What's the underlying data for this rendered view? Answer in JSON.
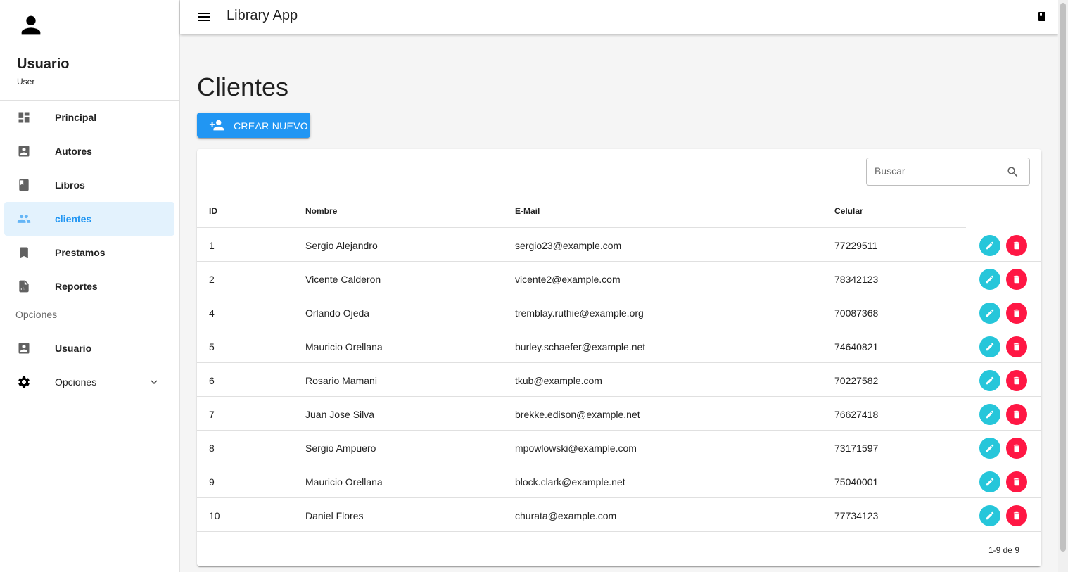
{
  "app": {
    "title": "Library App"
  },
  "profile": {
    "name": "Usuario",
    "role": "User"
  },
  "sidebar": {
    "items": [
      {
        "label": "Principal",
        "icon": "dashboard-icon"
      },
      {
        "label": "Autores",
        "icon": "account-box-icon"
      },
      {
        "label": "Libros",
        "icon": "book-icon"
      },
      {
        "label": "clientes",
        "icon": "people-icon",
        "active": true
      },
      {
        "label": "Prestamos",
        "icon": "bookmark-icon"
      },
      {
        "label": "Reportes",
        "icon": "report-icon"
      }
    ],
    "section_header": "Opciones",
    "options": [
      {
        "label": "Usuario",
        "icon": "account-box-icon"
      },
      {
        "label": "Opciones",
        "icon": "gear-icon",
        "expandable": true
      }
    ]
  },
  "page": {
    "title": "Clientes",
    "create_label": "CREAR NUEVO"
  },
  "search": {
    "placeholder": "Buscar"
  },
  "table": {
    "columns": [
      "ID",
      "Nombre",
      "E-Mail",
      "Celular"
    ],
    "rows": [
      {
        "id": "1",
        "nombre": "Sergio Alejandro",
        "email": "sergio23@example.com",
        "celular": "77229511"
      },
      {
        "id": "2",
        "nombre": "Vicente Calderon",
        "email": "vicente2@example.com",
        "celular": "78342123"
      },
      {
        "id": "4",
        "nombre": "Orlando Ojeda",
        "email": "tremblay.ruthie@example.org",
        "celular": "70087368"
      },
      {
        "id": "5",
        "nombre": "Mauricio Orellana",
        "email": "burley.schaefer@example.net",
        "celular": "74640821"
      },
      {
        "id": "6",
        "nombre": "Rosario Mamani",
        "email": "tkub@example.com",
        "celular": "70227582"
      },
      {
        "id": "7",
        "nombre": "Juan Jose Silva",
        "email": "brekke.edison@example.net",
        "celular": "76627418"
      },
      {
        "id": "8",
        "nombre": "Sergio Ampuero",
        "email": "mpowlowski@example.com",
        "celular": "73171597"
      },
      {
        "id": "9",
        "nombre": "Mauricio Orellana",
        "email": "block.clark@example.net",
        "celular": "75040001"
      },
      {
        "id": "10",
        "nombre": "Daniel Flores",
        "email": "churata@example.com",
        "celular": "77734123"
      }
    ],
    "pagination": "1-9 de 9"
  },
  "colors": {
    "primary": "#2196f3",
    "edit": "#26c6da",
    "delete": "#ff1744",
    "active_bg": "#e3f2fd"
  }
}
